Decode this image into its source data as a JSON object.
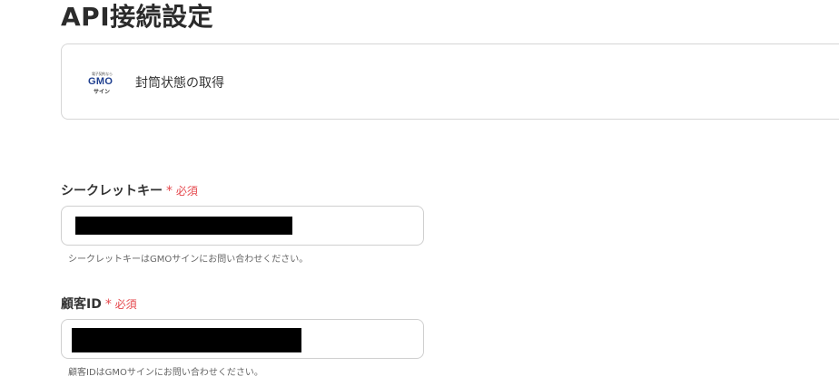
{
  "page": {
    "title": "API接続設定"
  },
  "action_card": {
    "logo": {
      "tagline": "電子契約なら",
      "wordmark": "GMO",
      "sub": "サイン",
      "icon": "gmo-sign-logo"
    },
    "label": "封筒状態の取得"
  },
  "fields": {
    "secret_key": {
      "label": "シークレットキー",
      "required_mark": "*",
      "required_text": "必須",
      "value": "",
      "helper": "シークレットキーはGMOサインにお問い合わせください。"
    },
    "customer_id": {
      "label": "顧客ID",
      "required_mark": "*",
      "required_text": "必須",
      "value": "",
      "helper": "顧客IDはGMOサインにお問い合わせください。"
    }
  },
  "colors": {
    "required": "#e5484d",
    "logo_brand": "#1f3f8f",
    "border": "#cfcfcf",
    "redaction": "#000000"
  }
}
